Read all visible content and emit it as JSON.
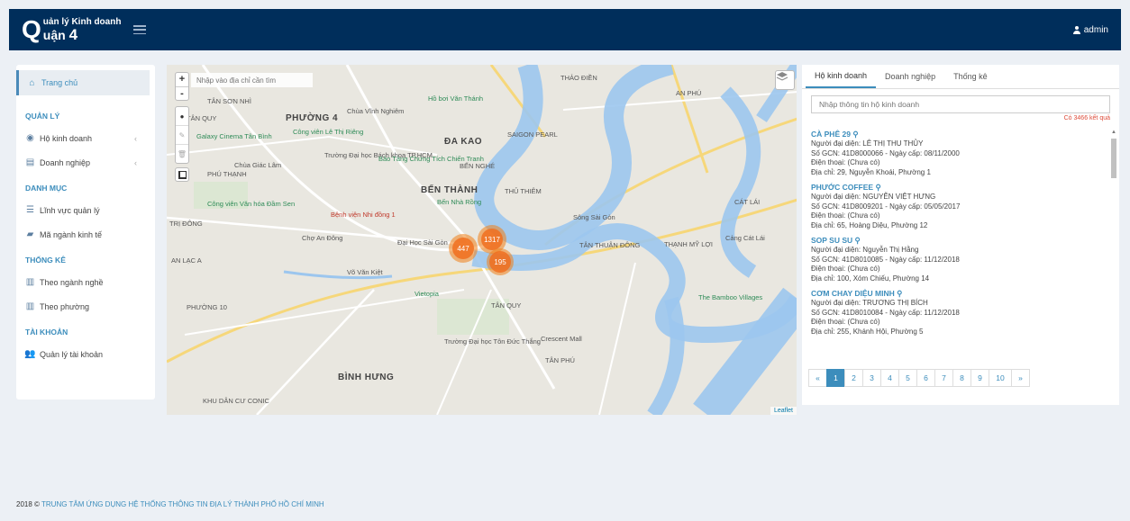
{
  "header": {
    "logo_letter": "Q",
    "logo_line1": "uản lý Kinh doanh",
    "logo_line2": "uận",
    "logo_number": "4",
    "user": "admin"
  },
  "sidebar": {
    "home": "Trang chủ",
    "sections": [
      {
        "title": "QUẢN LÝ",
        "items": [
          "Hộ kinh doanh",
          "Doanh nghiệp"
        ]
      },
      {
        "title": "DANH MỤC",
        "items": [
          "Lĩnh vực quản lý",
          "Mã ngành kinh tế"
        ]
      },
      {
        "title": "THỐNG KÊ",
        "items": [
          "Theo ngành nghề",
          "Theo phường"
        ]
      },
      {
        "title": "TÀI KHOẢN",
        "items": [
          "Quản lý tài khoản"
        ]
      }
    ]
  },
  "map": {
    "search_placeholder": "Nhập vào địa chỉ cần tìm",
    "zoom_in": "+",
    "zoom_out": "-",
    "clusters": [
      {
        "label": "447"
      },
      {
        "label": "1317"
      },
      {
        "label": "195"
      }
    ],
    "labels": {
      "tan_son_nhi": "TÂN SƠN NHÌ",
      "tan_quy": "TÂN QUY",
      "phuong4": "PHƯỜNG 4",
      "chua_vinh_nghiem": "Chùa Vĩnh Nghiêm",
      "ho_boi": "Hồ bơi Văn Thánh",
      "thao_dien": "THẢO ĐIỀN",
      "an_phu": "AN PHÚ",
      "galaxy": "Galaxy Cinema Tân Bình",
      "cong_vien_le_thi_rieng": "Công viên Lê Thị Riêng",
      "da_kao": "ĐA KAO",
      "saigon_pearl": "SAIGON PEARL",
      "truong_dai_hoc": "Trường Đại học Bách khoa TP.HCM",
      "chua_giac_lam": "Chùa Giác Lâm",
      "phu_thanh": "PHÚ THẠNH",
      "bao_tang": "Bảo Tàng Chứng Tích Chiến Tranh",
      "ben_nghe": "BẾN NGHÉ",
      "ben_thanh": "BẾN THÀNH",
      "thu_thiem": "THỦ THIÊM",
      "ben_nha_rong": "Bến Nhà Rồng",
      "cat_lai": "CÁT LÁI",
      "cong_vien_van_hoa": "Công viên Văn hóa Đầm Sen",
      "benh_vien": "Bệnh viện Nhi đồng 1",
      "tri_dong": "TRỊ ĐÔNG",
      "cho_an_dong": "Chợ An Đông",
      "dai_hoc_sai_gon": "Đại Học Sài Gòn",
      "tan_thuan_dong": "TÂN THUẬN ĐÔNG",
      "thanh_my_loi": "THẠNH MỸ LỢI",
      "cang_cat_lai": "Cảng Cát Lái",
      "an_lac_a": "AN LẠC A",
      "vo_van_kiet": "Võ Văn Kiệt",
      "vietopia": "Vietopia",
      "tan_quy2": "TÂN QUY",
      "bamboo": "The Bamboo Villages",
      "phuong10": "PHƯỜNG 10",
      "crescent": "Crescent Mall",
      "truong_dai_hoc_ton_duc_thang": "Trường Đại học Tôn Đức Thắng",
      "tan_phu": "TÂN PHÚ",
      "binh_hung": "BÌNH HƯNG",
      "khu_dan_cu": "KHU DÂN CƯ CONIC",
      "song_sai_gon": "Sông Sài Gòn"
    },
    "attribution": "Leaflet"
  },
  "panel": {
    "tabs": [
      "Hộ kinh doanh",
      "Doanh nghiệp",
      "Thống kê"
    ],
    "search_placeholder": "Nhập thông tin hộ kinh doanh",
    "result_count": "Có 3466 kết quả",
    "businesses": [
      {
        "name": "CÀ PHÊ 29",
        "rep": "Người đại diện: LÊ THỊ THU THỦY",
        "gcn": "Số GCN: 41D8000066 - Ngày cấp: 08/11/2000",
        "phone": "Điện thoại: (Chưa có)",
        "addr": "Địa chỉ: 29, Nguyễn Khoái, Phường 1"
      },
      {
        "name": "PHƯỚC COFFEE",
        "rep": "Người đại diện: NGUYỄN VIỆT HƯNG",
        "gcn": "Số GCN: 41D8009201 - Ngày cấp: 05/05/2017",
        "phone": "Điện thoại: (Chưa có)",
        "addr": "Địa chỉ: 65, Hoàng Diệu, Phường 12"
      },
      {
        "name": "SOP SU SU",
        "rep": "Người đại diện: Nguyễn Thị Hằng",
        "gcn": "Số GCN: 41D8010085 - Ngày cấp: 11/12/2018",
        "phone": "Điện thoại: (Chưa có)",
        "addr": "Địa chỉ: 100, Xóm Chiếu, Phường 14"
      },
      {
        "name": "CƠM CHAY DIỆU MINH",
        "rep": "Người đại diện: TRƯƠNG THỊ BÍCH",
        "gcn": "Số GCN: 41D8010084 - Ngày cấp: 11/12/2018",
        "phone": "Điện thoại: (Chưa có)",
        "addr": "Địa chỉ: 255, Khánh Hội, Phường 5"
      }
    ],
    "pages": [
      "«",
      "1",
      "2",
      "3",
      "4",
      "5",
      "6",
      "7",
      "8",
      "9",
      "10",
      "»"
    ],
    "active_page": "1"
  },
  "footer": {
    "year": "2018 ©",
    "org": "TRUNG TÂM ỨNG DỤNG HỆ THỐNG THÔNG TIN ĐỊA LÝ THÀNH PHỐ HỒ CHÍ MINH"
  },
  "colors": {
    "header": "#002e5b",
    "accent": "#3c8dbc",
    "cluster": "#f07e1e",
    "river": "#9cc6ee"
  }
}
